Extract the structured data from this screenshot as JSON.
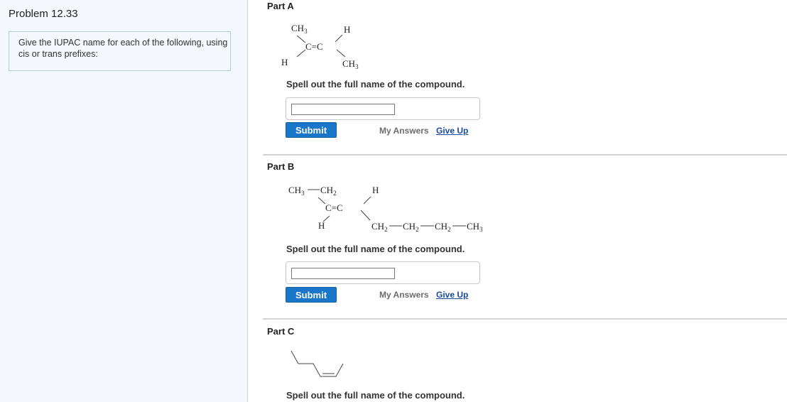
{
  "problem": {
    "title": "Problem 12.33",
    "instructions": "Give the IUPAC name for each of the following, using cis or trans prefixes:"
  },
  "common": {
    "prompt": "Spell out the full name of the compound.",
    "submit_label": "Submit",
    "my_answers_label": "My Answers",
    "give_up_label": "Give Up"
  },
  "parts": [
    {
      "label": "Part A",
      "answer_value": "",
      "structure": {
        "top_left": "CH",
        "top_left_sub": "3",
        "top_right": "H",
        "center": "C=C",
        "bottom_left": "H",
        "bottom_right": "CH",
        "bottom_right_sub": "3"
      }
    },
    {
      "label": "Part B",
      "answer_value": "",
      "structure": {
        "top_left": "CH",
        "top_left_sub": "3",
        "top_left2": "CH",
        "top_left2_sub": "2",
        "top_right": "H",
        "center": "C=C",
        "bottom_left": "H",
        "chain": [
          {
            "t": "CH",
            "s": "2"
          },
          {
            "t": "CH",
            "s": "2"
          },
          {
            "t": "CH",
            "s": "2"
          },
          {
            "t": "CH",
            "s": "3"
          }
        ]
      }
    },
    {
      "label": "Part C"
    }
  ]
}
